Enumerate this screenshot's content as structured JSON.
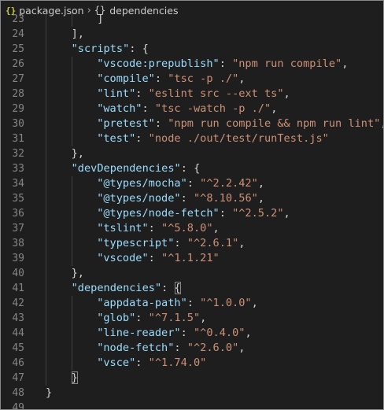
{
  "breadcrumb": {
    "file_icon": "{}",
    "file": "package.json",
    "separator": "›",
    "symbol_icon": "{}",
    "symbol": "dependencies"
  },
  "lines": [
    {
      "n": "23",
      "indent": 2,
      "tokens": [
        {
          "t": "]",
          "c": "pun"
        }
      ]
    },
    {
      "n": "24",
      "indent": 1,
      "tokens": [
        {
          "t": "],",
          "c": "pun"
        }
      ]
    },
    {
      "n": "25",
      "indent": 1,
      "tokens": [
        {
          "t": "\"scripts\"",
          "c": "key"
        },
        {
          "t": ": {",
          "c": "pun"
        }
      ]
    },
    {
      "n": "26",
      "indent": 2,
      "tokens": [
        {
          "t": "\"vscode:prepublish\"",
          "c": "key"
        },
        {
          "t": ": ",
          "c": "pun"
        },
        {
          "t": "\"npm run compile\"",
          "c": "str"
        },
        {
          "t": ",",
          "c": "pun"
        }
      ]
    },
    {
      "n": "27",
      "indent": 2,
      "tokens": [
        {
          "t": "\"compile\"",
          "c": "key"
        },
        {
          "t": ": ",
          "c": "pun"
        },
        {
          "t": "\"tsc -p ./\"",
          "c": "str"
        },
        {
          "t": ",",
          "c": "pun"
        }
      ]
    },
    {
      "n": "28",
      "indent": 2,
      "tokens": [
        {
          "t": "\"lint\"",
          "c": "key"
        },
        {
          "t": ": ",
          "c": "pun"
        },
        {
          "t": "\"eslint src --ext ts\"",
          "c": "str"
        },
        {
          "t": ",",
          "c": "pun"
        }
      ]
    },
    {
      "n": "29",
      "indent": 2,
      "tokens": [
        {
          "t": "\"watch\"",
          "c": "key"
        },
        {
          "t": ": ",
          "c": "pun"
        },
        {
          "t": "\"tsc -watch -p ./\"",
          "c": "str"
        },
        {
          "t": ",",
          "c": "pun"
        }
      ]
    },
    {
      "n": "30",
      "indent": 2,
      "tokens": [
        {
          "t": "\"pretest\"",
          "c": "key"
        },
        {
          "t": ": ",
          "c": "pun"
        },
        {
          "t": "\"npm run compile && npm run lint\"",
          "c": "str"
        },
        {
          "t": ",",
          "c": "pun"
        }
      ]
    },
    {
      "n": "31",
      "indent": 2,
      "tokens": [
        {
          "t": "\"test\"",
          "c": "key"
        },
        {
          "t": ": ",
          "c": "pun"
        },
        {
          "t": "\"node ./out/test/runTest.js\"",
          "c": "str"
        }
      ]
    },
    {
      "n": "32",
      "indent": 1,
      "tokens": [
        {
          "t": "},",
          "c": "pun"
        }
      ]
    },
    {
      "n": "33",
      "indent": 1,
      "tokens": [
        {
          "t": "\"devDependencies\"",
          "c": "key"
        },
        {
          "t": ": {",
          "c": "pun"
        }
      ]
    },
    {
      "n": "34",
      "indent": 2,
      "tokens": [
        {
          "t": "\"@types/mocha\"",
          "c": "key"
        },
        {
          "t": ": ",
          "c": "pun"
        },
        {
          "t": "\"^2.2.42\"",
          "c": "str"
        },
        {
          "t": ",",
          "c": "pun"
        }
      ]
    },
    {
      "n": "35",
      "indent": 2,
      "tokens": [
        {
          "t": "\"@types/node\"",
          "c": "key"
        },
        {
          "t": ": ",
          "c": "pun"
        },
        {
          "t": "\"^8.10.56\"",
          "c": "str"
        },
        {
          "t": ",",
          "c": "pun"
        }
      ]
    },
    {
      "n": "36",
      "indent": 2,
      "tokens": [
        {
          "t": "\"@types/node-fetch\"",
          "c": "key"
        },
        {
          "t": ": ",
          "c": "pun"
        },
        {
          "t": "\"^2.5.2\"",
          "c": "str"
        },
        {
          "t": ",",
          "c": "pun"
        }
      ]
    },
    {
      "n": "37",
      "indent": 2,
      "tokens": [
        {
          "t": "\"tslint\"",
          "c": "key"
        },
        {
          "t": ": ",
          "c": "pun"
        },
        {
          "t": "\"^5.8.0\"",
          "c": "str"
        },
        {
          "t": ",",
          "c": "pun"
        }
      ]
    },
    {
      "n": "38",
      "indent": 2,
      "tokens": [
        {
          "t": "\"typescript\"",
          "c": "key"
        },
        {
          "t": ": ",
          "c": "pun"
        },
        {
          "t": "\"^2.6.1\"",
          "c": "str"
        },
        {
          "t": ",",
          "c": "pun"
        }
      ]
    },
    {
      "n": "39",
      "indent": 2,
      "tokens": [
        {
          "t": "\"vscode\"",
          "c": "key"
        },
        {
          "t": ": ",
          "c": "pun"
        },
        {
          "t": "\"^1.1.21\"",
          "c": "str"
        }
      ]
    },
    {
      "n": "40",
      "indent": 1,
      "tokens": [
        {
          "t": "},",
          "c": "pun"
        }
      ]
    },
    {
      "n": "41",
      "indent": 1,
      "tokens": [
        {
          "t": "\"dependencies\"",
          "c": "key"
        },
        {
          "t": ": ",
          "c": "pun"
        },
        {
          "t": "{",
          "c": "pun",
          "hl": true
        }
      ]
    },
    {
      "n": "42",
      "indent": 2,
      "tokens": [
        {
          "t": "\"appdata-path\"",
          "c": "key"
        },
        {
          "t": ": ",
          "c": "pun"
        },
        {
          "t": "\"^1.0.0\"",
          "c": "str"
        },
        {
          "t": ",",
          "c": "pun"
        }
      ]
    },
    {
      "n": "43",
      "indent": 2,
      "tokens": [
        {
          "t": "\"glob\"",
          "c": "key"
        },
        {
          "t": ": ",
          "c": "pun"
        },
        {
          "t": "\"^7.1.5\"",
          "c": "str"
        },
        {
          "t": ",",
          "c": "pun"
        }
      ]
    },
    {
      "n": "44",
      "indent": 2,
      "tokens": [
        {
          "t": "\"line-reader\"",
          "c": "key"
        },
        {
          "t": ": ",
          "c": "pun"
        },
        {
          "t": "\"^0.4.0\"",
          "c": "str"
        },
        {
          "t": ",",
          "c": "pun"
        }
      ]
    },
    {
      "n": "45",
      "indent": 2,
      "tokens": [
        {
          "t": "\"node-fetch\"",
          "c": "key"
        },
        {
          "t": ": ",
          "c": "pun"
        },
        {
          "t": "\"^2.6.0\"",
          "c": "str"
        },
        {
          "t": ",",
          "c": "pun"
        }
      ]
    },
    {
      "n": "46",
      "indent": 2,
      "tokens": [
        {
          "t": "\"vsce\"",
          "c": "key"
        },
        {
          "t": ": ",
          "c": "pun"
        },
        {
          "t": "\"^1.74.0\"",
          "c": "str"
        }
      ]
    },
    {
      "n": "47",
      "indent": 1,
      "tokens": [
        {
          "t": "}",
          "c": "pun",
          "hl": true
        }
      ]
    },
    {
      "n": "48",
      "indent": 0,
      "tokens": [
        {
          "t": "}",
          "c": "pun"
        }
      ]
    },
    {
      "n": "49",
      "indent": 0,
      "tokens": []
    }
  ],
  "colors": {
    "background": "#1e1e1e",
    "key": "#9cdcfe",
    "string": "#ce9178",
    "punctuation": "#d4d4d4",
    "line_number": "#858585",
    "json_icon": "#cbcb41"
  }
}
